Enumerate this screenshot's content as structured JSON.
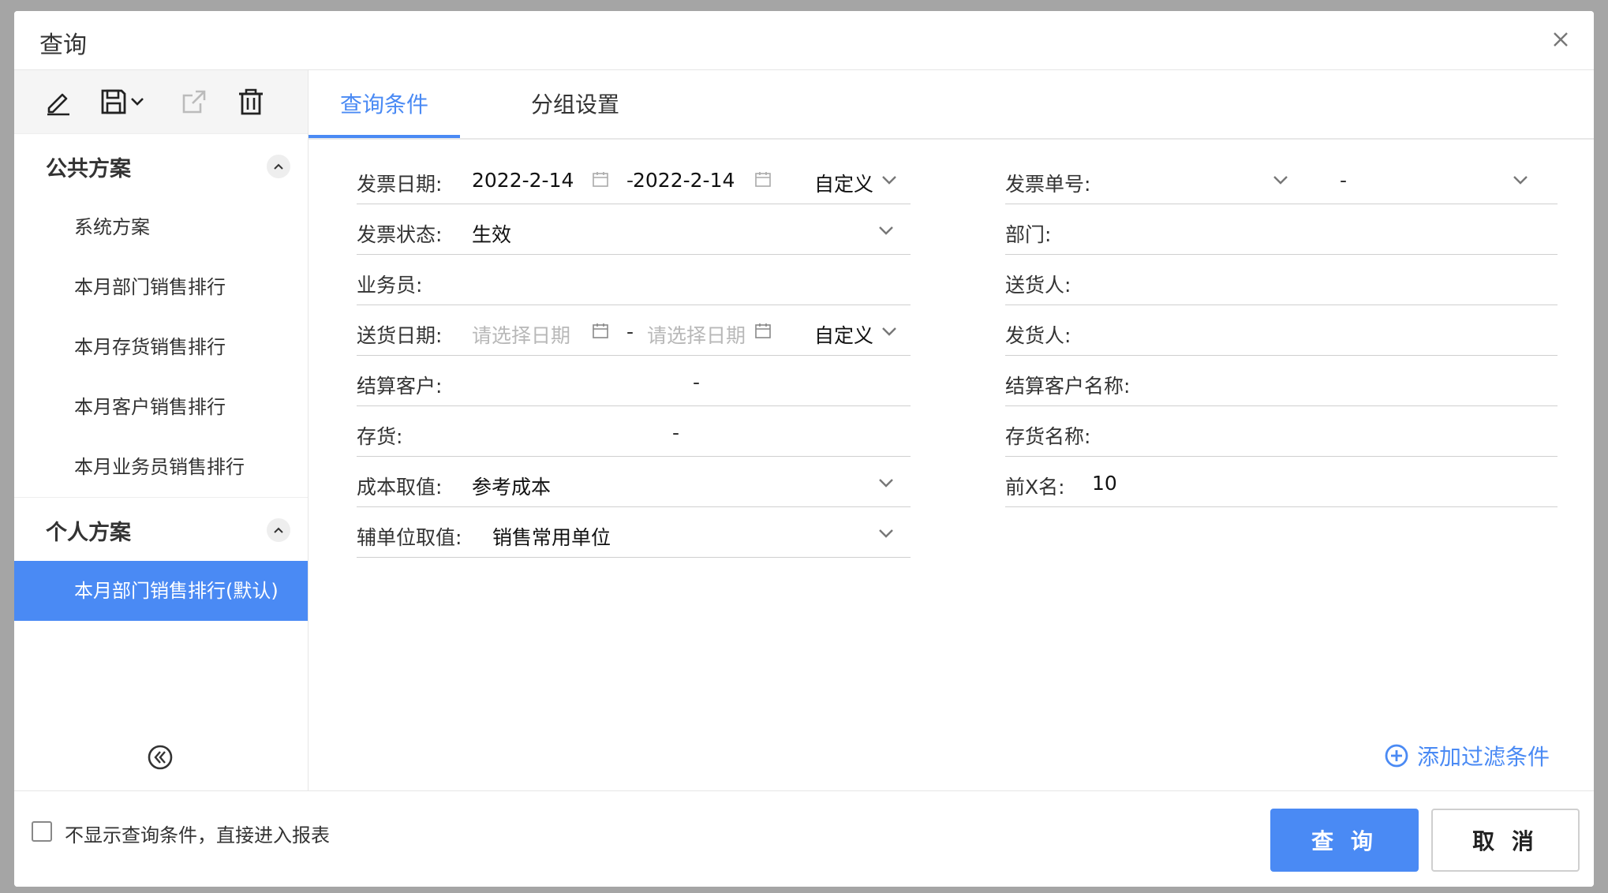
{
  "dialog": {
    "title": "查询"
  },
  "sidebar": {
    "public_group": "公共方案",
    "public_items": [
      "系统方案",
      "本月部门销售排行",
      "本月存货销售排行",
      "本月客户销售排行",
      "本月业务员销售排行"
    ],
    "personal_group": "个人方案",
    "personal_items": [
      "本月部门销售排行(默认)"
    ]
  },
  "tabs": [
    {
      "label": "查询条件",
      "active": true
    },
    {
      "label": "分组设置",
      "active": false
    }
  ],
  "form": {
    "invoice_date": {
      "label": "发票日期:",
      "from": "2022-2-14",
      "to": "2022-2-14",
      "range": "自定义"
    },
    "invoice_status": {
      "label": "发票状态:",
      "value": "生效"
    },
    "salesperson": {
      "label": "业务员:"
    },
    "delivery_date": {
      "label": "送货日期:",
      "from_placeholder": "请选择日期",
      "to_placeholder": "请选择日期",
      "range": "自定义"
    },
    "settle_customer": {
      "label": "结算客户:"
    },
    "inventory": {
      "label": "存货:"
    },
    "cost_value": {
      "label": "成本取值:",
      "value": "参考成本"
    },
    "aux_unit": {
      "label": "辅单位取值:",
      "value": "销售常用单位"
    },
    "invoice_no": {
      "label": "发票单号:"
    },
    "department": {
      "label": "部门:"
    },
    "deliverer": {
      "label": "送货人:"
    },
    "shipper": {
      "label": "发货人:"
    },
    "settle_customer_name": {
      "label": "结算客户名称:"
    },
    "inventory_name": {
      "label": "存货名称:"
    },
    "top_x": {
      "label": "前X名:",
      "value": "10"
    },
    "dash": "-"
  },
  "add_filter": "添加过滤条件",
  "footer": {
    "checkbox_label": "不显示查询条件，直接进入报表",
    "query_button": "查 询",
    "cancel_button": "取 消"
  },
  "colors": {
    "accent": "#4a8af4"
  }
}
